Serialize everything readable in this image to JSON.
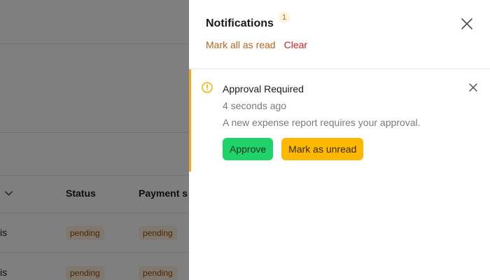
{
  "background": {
    "table": {
      "headers": [
        "Status",
        "Payment s"
      ],
      "rows": [
        {
          "cell_fragment": "is",
          "status": "pending",
          "payment": "pending"
        },
        {
          "cell_fragment": "is",
          "status": "pending",
          "payment": "pending"
        }
      ]
    }
  },
  "drawer": {
    "title": "Notifications",
    "unread_count": "1",
    "actions": {
      "mark_all_read": "Mark all as read",
      "clear": "Clear"
    }
  },
  "notifications": [
    {
      "title": "Approval Required",
      "time": "4 seconds ago",
      "message": "A new expense report requires your approval.",
      "actions": {
        "approve": "Approve",
        "mark_unread": "Mark as unread"
      }
    }
  ],
  "colors": {
    "accent_warning": "#f5a623",
    "approve_button": "#1fd36a",
    "unread_button": "#ffb800",
    "mark_all_link": "#b5651d",
    "clear_link": "#d02020"
  },
  "icons": {
    "drawer_close": "close-icon",
    "notification_type": "warning-circle-icon",
    "notification_dismiss": "close-icon",
    "column_sort": "chevron-down-icon"
  }
}
